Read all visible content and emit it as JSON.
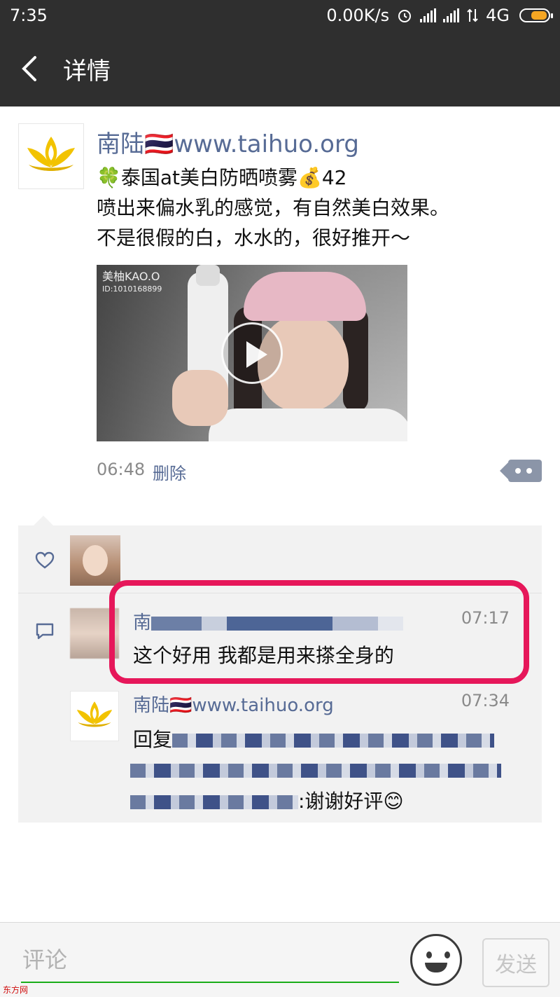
{
  "status_bar": {
    "time": "7:35",
    "net_speed": "0.00K/s",
    "network_type": "4G"
  },
  "header": {
    "title": "详情"
  },
  "post": {
    "author": "南陆🇹🇭www.taihuo.org",
    "lines": [
      "🍀泰国at美白防晒喷雾💰42",
      "喷出来偏水乳的感觉，有自然美白效果。",
      "不是很假的白，水水的，很好推开～"
    ],
    "video_watermark": "美柚KAO.O",
    "video_watermark_id": "ID:1010168899",
    "time": "06:48",
    "delete_label": "删除"
  },
  "comments": [
    {
      "author": "南",
      "time": "07:17",
      "text": "这个好用 我都是用来搽全身的"
    },
    {
      "author": "南陆🇹🇭www.taihuo.org",
      "time": "07:34",
      "reply_prefix": "回复",
      "reply_suffix": ":谢谢好评😊"
    }
  ],
  "input_bar": {
    "placeholder": "评论",
    "send_label": "发送"
  },
  "corner_mark": "东方网",
  "colors": {
    "link": "#576b95",
    "highlight": "#e6175a",
    "input_underline": "#1aad19"
  }
}
